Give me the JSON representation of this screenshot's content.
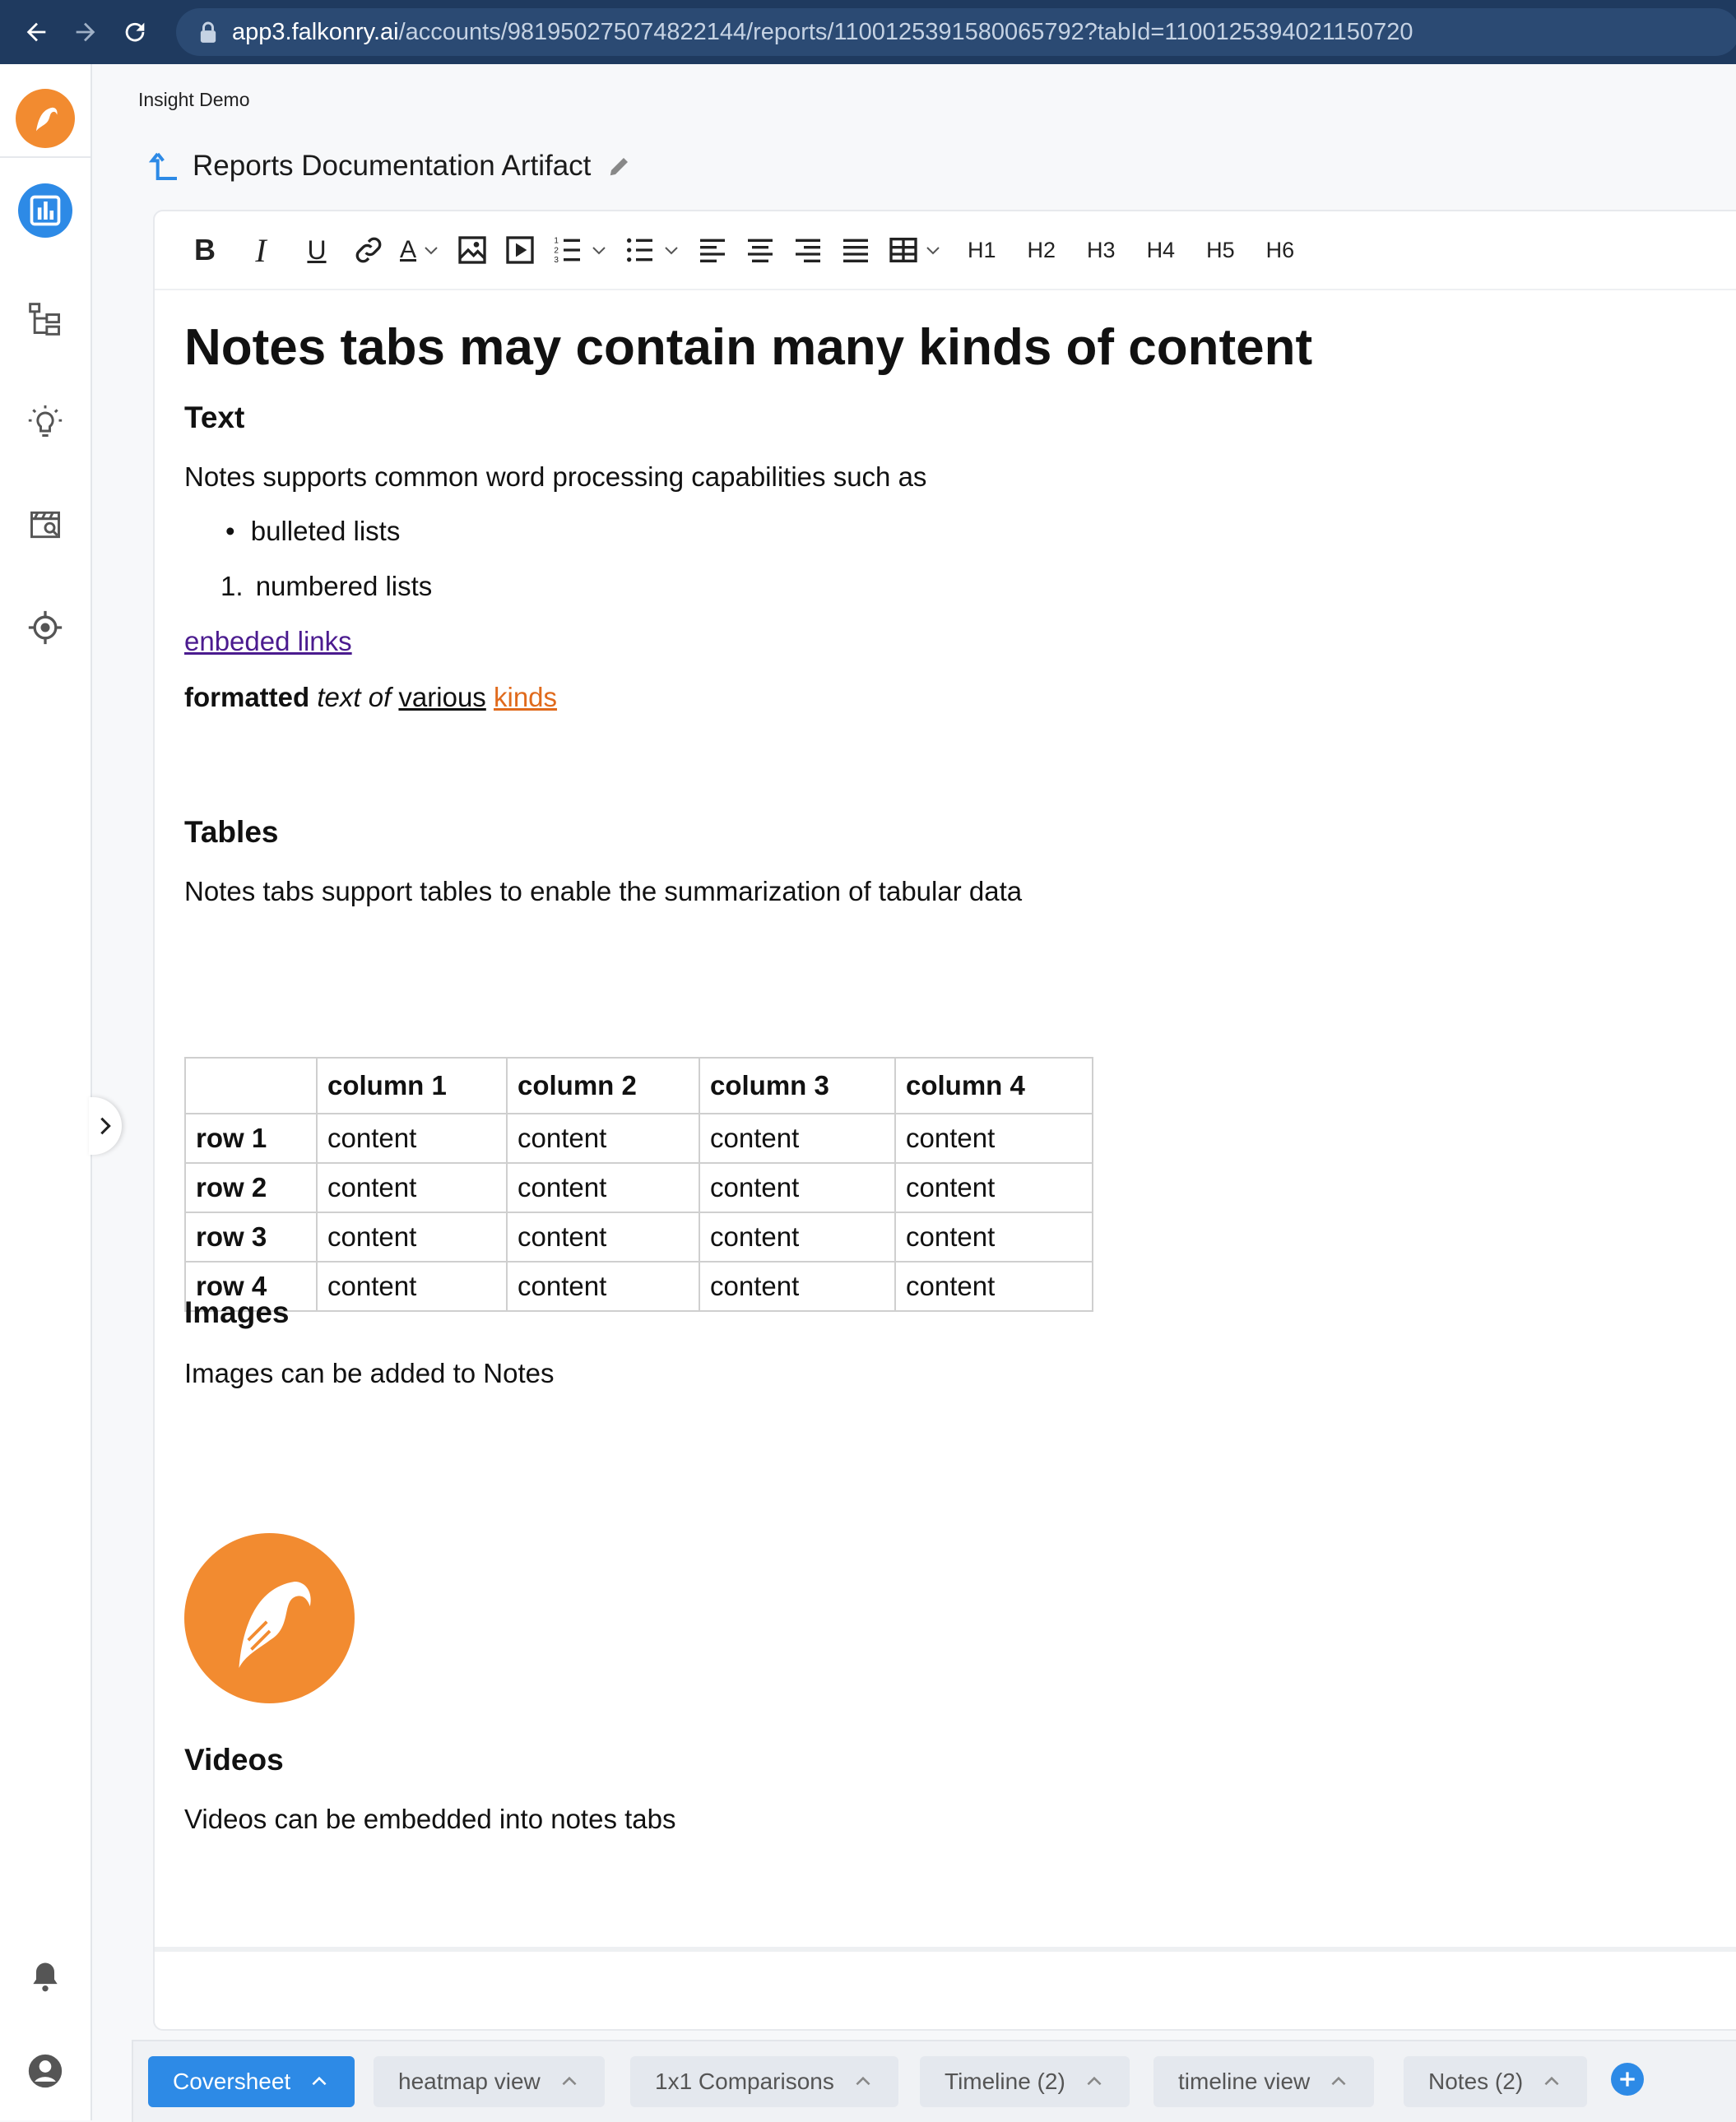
{
  "browser": {
    "url_host": "app3.falkonry.ai",
    "url_path": "/accounts/981950275074822144/reports/1100125391580065792?tabId=1100125394021150720"
  },
  "header": {
    "workspace": "Insight Demo",
    "report_title": "Reports Documentation Artifact"
  },
  "toolbar": {
    "bold": "B",
    "italic": "I",
    "underline": "U",
    "font_color": "A",
    "headings": [
      "H1",
      "H2",
      "H3",
      "H4",
      "H5",
      "H6"
    ]
  },
  "content": {
    "title": "Notes tabs may contain many kinds of content",
    "text_section": {
      "heading": "Text",
      "intro": "Notes supports common word processing capabilities such as",
      "bullet_item": "bulleted lists",
      "numbered_marker": "1.",
      "numbered_item": "numbered lists",
      "link": "enbeded links",
      "fmt_bold": "formatted",
      "fmt_italic": "text of",
      "fmt_underline": "various",
      "fmt_colored": "kinds"
    },
    "tables_section": {
      "heading": "Tables",
      "intro": "Notes tabs support tables to enable the summarization of tabular data",
      "table": {
        "headers": [
          "",
          "column 1",
          "column 2",
          "column 3",
          "column 4"
        ],
        "rows": [
          [
            "row 1",
            "content",
            "content",
            "content",
            "content"
          ],
          [
            "row 2",
            "content",
            "content",
            "content",
            "content"
          ],
          [
            "row 3",
            "content",
            "content",
            "content",
            "content"
          ],
          [
            "row 4",
            "content",
            "content",
            "content",
            "content"
          ]
        ]
      }
    },
    "images_section": {
      "heading": "Images",
      "intro": "Images can be added to Notes"
    },
    "videos_section": {
      "heading": "Videos",
      "intro": "Videos can be embedded into notes tabs"
    }
  },
  "tabs": [
    {
      "label": "Coversheet",
      "active": true
    },
    {
      "label": "heatmap view",
      "active": false
    },
    {
      "label": "1x1 Comparisons",
      "active": false
    },
    {
      "label": "Timeline (2)",
      "active": false
    },
    {
      "label": "timeline view",
      "active": false
    },
    {
      "label": "Notes (2)",
      "active": false
    }
  ],
  "colors": {
    "brand_orange": "#f28b30",
    "accent_blue": "#2d8ae6",
    "link_purple": "#4b1b8f",
    "formatted_orange": "#e06a1c",
    "browser_bar": "#1f3a5f"
  }
}
